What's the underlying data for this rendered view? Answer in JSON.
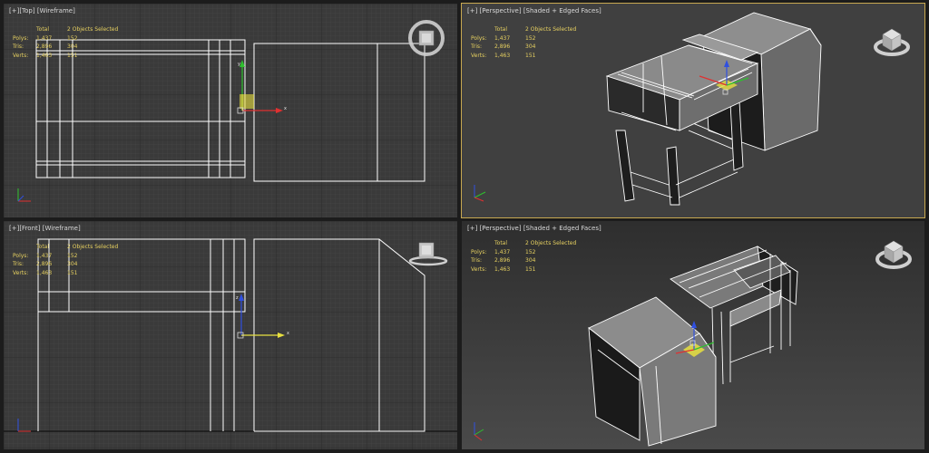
{
  "viewports": [
    {
      "id": "top",
      "label": {
        "plus": "[+]",
        "view": "[Top]",
        "mode": "[Wireframe]"
      }
    },
    {
      "id": "persp1",
      "label": {
        "plus": "[+]",
        "view": "[Perspective]",
        "mode": "[Shaded + Edged Faces]"
      }
    },
    {
      "id": "front",
      "label": {
        "plus": "[+]",
        "view": "[Front]",
        "mode": "[Wireframe]"
      }
    },
    {
      "id": "persp2",
      "label": {
        "plus": "[+]",
        "view": "[Perspective]",
        "mode": "[Shaded + Edged Faces]"
      }
    }
  ],
  "stats": {
    "header_total": "Total",
    "header_selected": "2 Objects Selected",
    "rows": [
      {
        "label": "Polys:",
        "total": "1,437",
        "selected": "152"
      },
      {
        "label": "Tris:",
        "total": "2,896",
        "selected": "304"
      },
      {
        "label": "Verts:",
        "total": "1,463",
        "selected": "151"
      }
    ]
  },
  "gizmo_labels": {
    "x": "x",
    "y": "y",
    "z": "z"
  },
  "colors": {
    "wire_bg": "#3a3a3a",
    "grid_minor": "#4a4a4a",
    "grid_major": "#222222",
    "wire": "#ffffff",
    "shaded_face_light": "#8a8a8a",
    "shaded_face_mid": "#6e6e6e",
    "shaded_face_dark": "#1a1a1a",
    "stats_text": "#e6d060",
    "active_border": "#c8a850",
    "axis_x": "#e03030",
    "axis_y": "#2ec02e",
    "axis_z": "#3050e0",
    "gizmo_plane": "#e8e040"
  },
  "icons": [
    "viewcube-icon",
    "axis-tripod-icon",
    "move-gizmo-icon"
  ]
}
